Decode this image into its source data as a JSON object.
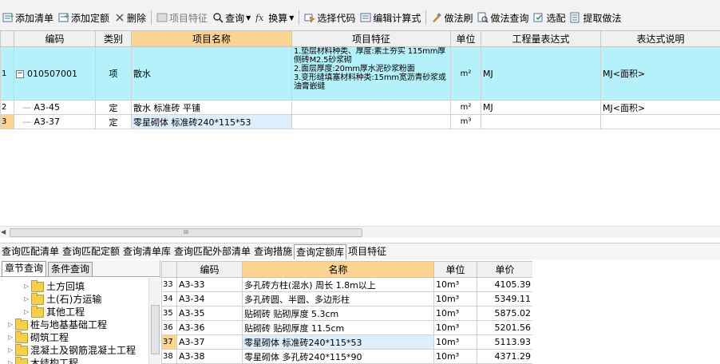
{
  "toolbar": {
    "add_list": "添加清单",
    "add_quota": "添加定额",
    "delete": "删除",
    "item_feature": "项目特征",
    "query": "查询",
    "convert": "换算",
    "select_code": "选择代码",
    "edit_formula": "编辑计算式",
    "method_brush": "做法刷",
    "method_query": "做法查询",
    "match": "选配",
    "extract": "提取做法"
  },
  "top_grid": {
    "headers": [
      "编码",
      "类别",
      "项目名称",
      "项目特征",
      "单位",
      "工程量表达式",
      "表达式说明"
    ],
    "rows": [
      {
        "num": "1",
        "code": "010507001",
        "type": "项",
        "name": "散水",
        "feature": "1.垫层材料种类、厚度:素土夯实 115mm厚侧砖M2.5砂浆砌\n2.面层厚度:20mm厚水泥砂浆粉面\n3.变形缝填塞材料种类:15mm宽沥青砂浆或油膏嵌缝",
        "unit": "m²",
        "expr": "MJ",
        "desc": "MJ<面积>"
      },
      {
        "num": "2",
        "code": "A3-45",
        "type": "定",
        "name": "散水 标准砖 平铺",
        "feature": "",
        "unit": "m²",
        "expr": "MJ",
        "desc": "MJ<面积>"
      },
      {
        "num": "3",
        "code": "A3-37",
        "type": "定",
        "name": "零星砌体 标准砖240*115*53",
        "feature": "",
        "unit": "m³",
        "expr": "",
        "desc": ""
      }
    ]
  },
  "bottom_tabs": [
    "查询匹配清单",
    "查询匹配定额",
    "查询清单库",
    "查询匹配外部清单",
    "查询措施",
    "查询定额库",
    "项目特征"
  ],
  "left_tabs": [
    "章节查询",
    "条件查询"
  ],
  "tree": [
    {
      "label": "土方回填",
      "level": 2
    },
    {
      "label": "土(石)方运输",
      "level": 2
    },
    {
      "label": "其他工程",
      "level": 2
    },
    {
      "label": "桩与地基基础工程",
      "level": 1
    },
    {
      "label": "砌筑工程",
      "level": 1
    },
    {
      "label": "混凝土及钢筋混凝土工程",
      "level": 1
    },
    {
      "label": "木结构工程",
      "level": 1
    }
  ],
  "bottom_grid": {
    "headers": [
      "编码",
      "名称",
      "单位",
      "单价"
    ],
    "rows": [
      {
        "num": "33",
        "code": "A3-33",
        "name": "多孔砖方柱(混水) 周长 1.8m以上",
        "unit": "10m³",
        "price": "4105.39"
      },
      {
        "num": "34",
        "code": "A3-34",
        "name": "多孔砖圆、半圆、多边形柱",
        "unit": "10m³",
        "price": "5349.11"
      },
      {
        "num": "35",
        "code": "A3-35",
        "name": "贴砌砖 贴砌厚度 5.3cm",
        "unit": "10m³",
        "price": "5875.02"
      },
      {
        "num": "36",
        "code": "A3-36",
        "name": "贴砌砖 贴砌厚度 11.5cm",
        "unit": "10m³",
        "price": "5201.56"
      },
      {
        "num": "37",
        "code": "A3-37",
        "name": "零星砌体 标准砖240*115*53",
        "unit": "10m³",
        "price": "5113.93"
      },
      {
        "num": "38",
        "code": "A3-38",
        "name": "零星砌体 多孔砖240*115*90",
        "unit": "10m³",
        "price": "4371.29"
      }
    ]
  },
  "scroll_grip": "III"
}
